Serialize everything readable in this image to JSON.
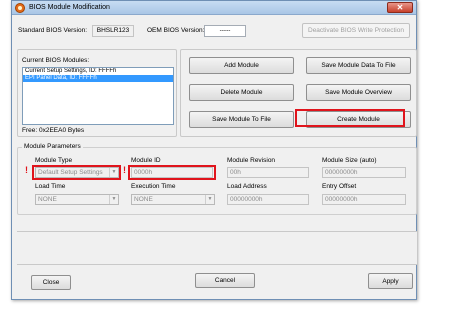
{
  "window": {
    "title": "BIOS Module Modification",
    "close_glyph": "✕"
  },
  "header": {
    "standard_bios_label": "Standard BIOS Version:",
    "standard_bios_value": "BHSLR123",
    "oem_bios_label": "OEM BIOS Version:",
    "oem_bios_value": "-----",
    "deactivate_button": "Deactivate BIOS Write Protection"
  },
  "modules": {
    "label": "Current BIOS Modules:",
    "items": [
      {
        "label": "Current Setup Settings, ID: FFFFh"
      },
      {
        "label": "EPI Panel Data, ID: FFFFh"
      }
    ],
    "free_text": "Free: 0x2EEA0 Bytes"
  },
  "actions": {
    "add_module": "Add  Module",
    "save_module_data": "Save Module Data To File",
    "delete_module": "Delete Module",
    "save_module_overview": "Save Module Overview",
    "save_module_to_file": "Save Module To File",
    "create_module": "Create Module"
  },
  "params": {
    "group_title": "Module Parameters",
    "module_type_label": "Module Type",
    "module_type_value": "Default Setup Settings",
    "module_id_label": "Module ID",
    "module_id_value": "0000h",
    "module_revision_label": "Module Revision",
    "module_revision_value": "00h",
    "module_size_label": "Module Size (auto)",
    "module_size_value": "00000000h",
    "load_time_label": "Load Time",
    "load_time_value": "NONE",
    "execution_time_label": "Execution Time",
    "execution_time_value": "NONE",
    "load_address_label": "Load Address",
    "load_address_value": "00000000h",
    "entry_offset_label": "Entry Offset",
    "entry_offset_value": "00000000h",
    "warning_glyph": "!"
  },
  "footer": {
    "close": "Close",
    "cancel": "Cancel",
    "apply": "Apply"
  },
  "colors": {
    "highlight": "#e0141c",
    "selection": "#3399ff"
  },
  "icons": {
    "app": "bios-app-icon",
    "dropdown": "chevron-down-icon"
  }
}
